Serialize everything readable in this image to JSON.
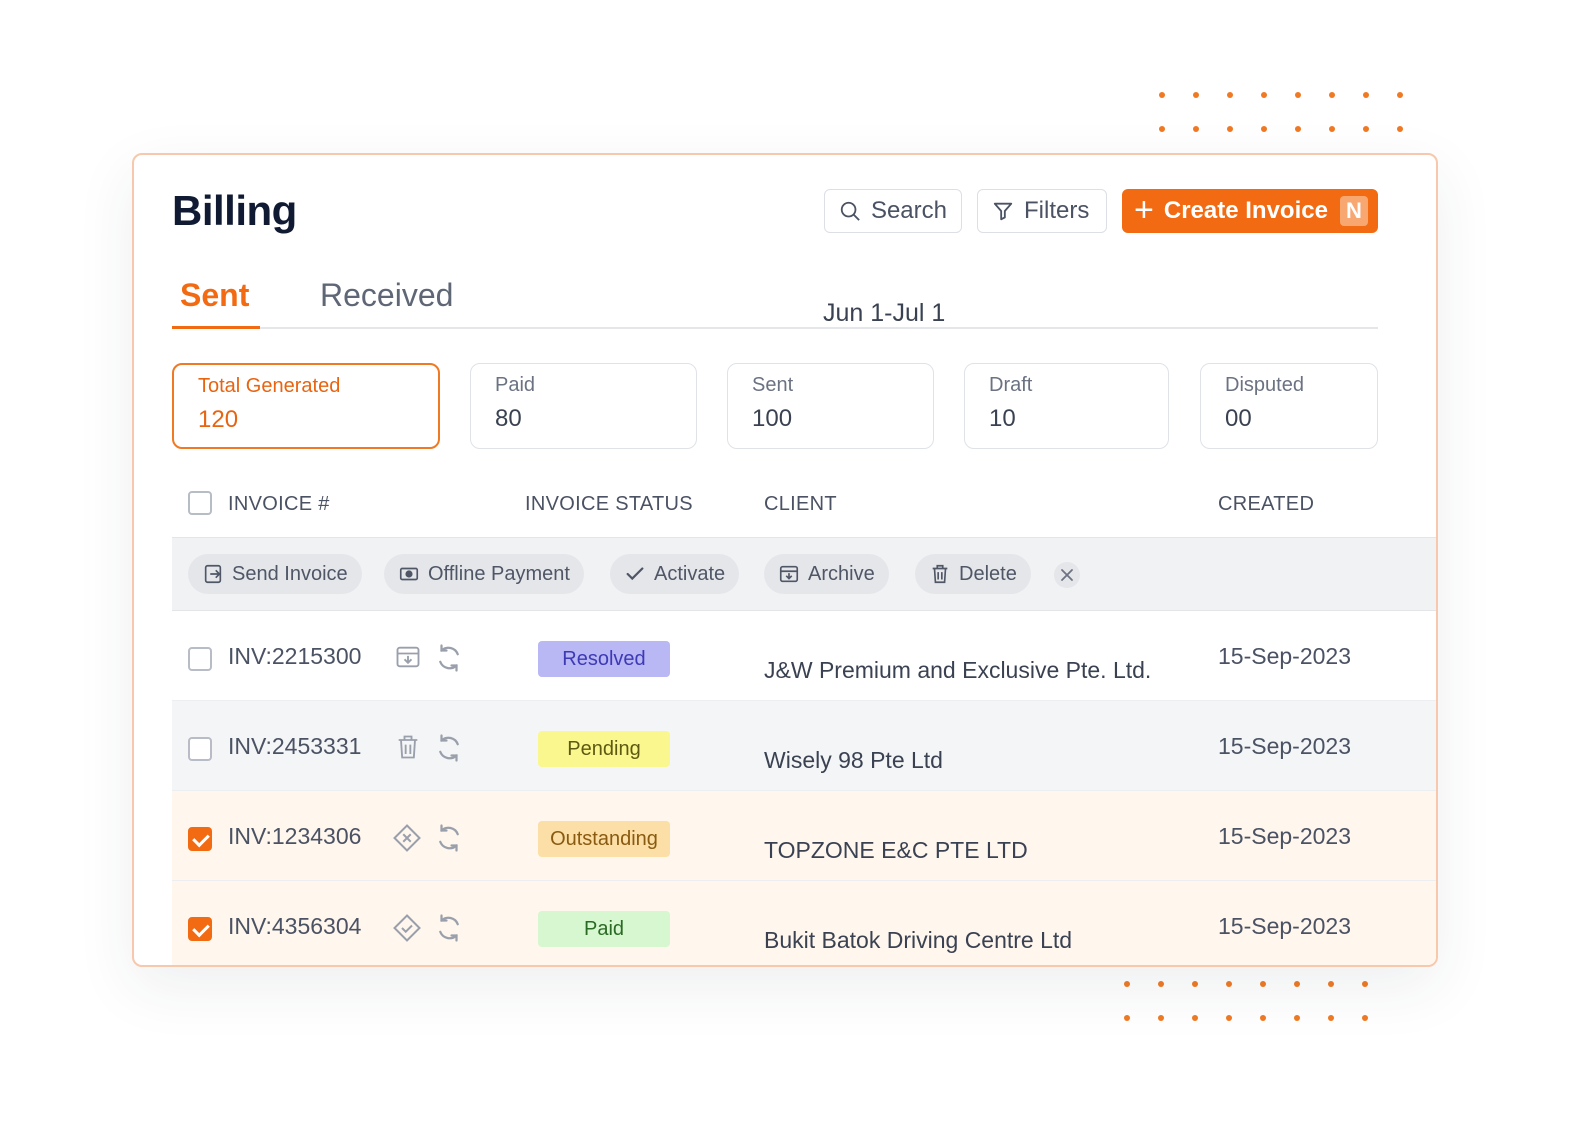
{
  "header": {
    "title": "Billing",
    "search_label": "Search",
    "filters_label": "Filters",
    "create_label": "Create Invoice",
    "create_shortcut": "N"
  },
  "tabs": [
    {
      "label": "Sent",
      "active": true
    },
    {
      "label": "Received",
      "active": false
    }
  ],
  "date_range": "Jun 1-Jul 1",
  "stats": [
    {
      "label": "Total Generated",
      "value": "120",
      "active": true
    },
    {
      "label": "Paid",
      "value": "80",
      "active": false
    },
    {
      "label": "Sent",
      "value": "100",
      "active": false
    },
    {
      "label": "Draft",
      "value": "10",
      "active": false
    },
    {
      "label": "Disputed",
      "value": "00",
      "active": false
    }
  ],
  "table": {
    "columns": [
      "INVOICE #",
      "INVOICE STATUS",
      "CLIENT",
      "CREATED"
    ],
    "bulk_actions": [
      {
        "label": "Send Invoice",
        "icon": "send-icon"
      },
      {
        "label": "Offline Payment",
        "icon": "cash-icon"
      },
      {
        "label": "Activate",
        "icon": "check-icon"
      },
      {
        "label": "Archive",
        "icon": "archive-icon"
      },
      {
        "label": "Delete",
        "icon": "trash-icon"
      }
    ],
    "rows": [
      {
        "invoice": "INV:2215300",
        "action_icon": "archive-icon",
        "status": "Resolved",
        "client": "J&W Premium and Exclusive Pte. Ltd.",
        "created": "15-Sep-2023",
        "checked": false
      },
      {
        "invoice": "INV:2453331",
        "action_icon": "trash-icon",
        "status": "Pending",
        "client": "Wisely 98 Pte Ltd",
        "created": "15-Sep-2023",
        "checked": false
      },
      {
        "invoice": "INV:1234306",
        "action_icon": "diamond-x-icon",
        "status": "Outstanding",
        "client": "TOPZONE E&C PTE LTD",
        "created": "15-Sep-2023",
        "checked": true
      },
      {
        "invoice": "INV:4356304",
        "action_icon": "diamond-check-icon",
        "status": "Paid",
        "client": "Bukit Batok Driving Centre Ltd",
        "created": "15-Sep-2023",
        "checked": true
      }
    ]
  },
  "colors": {
    "accent": "#f26b12",
    "resolved_bg": "#b9b7f4",
    "pending_bg": "#fbf78f",
    "outstanding_bg": "#fbdfa6",
    "paid_bg": "#d6f7cf",
    "selected_row_bg": "#fff6ee",
    "hover_row_bg": "#f4f5f7"
  }
}
